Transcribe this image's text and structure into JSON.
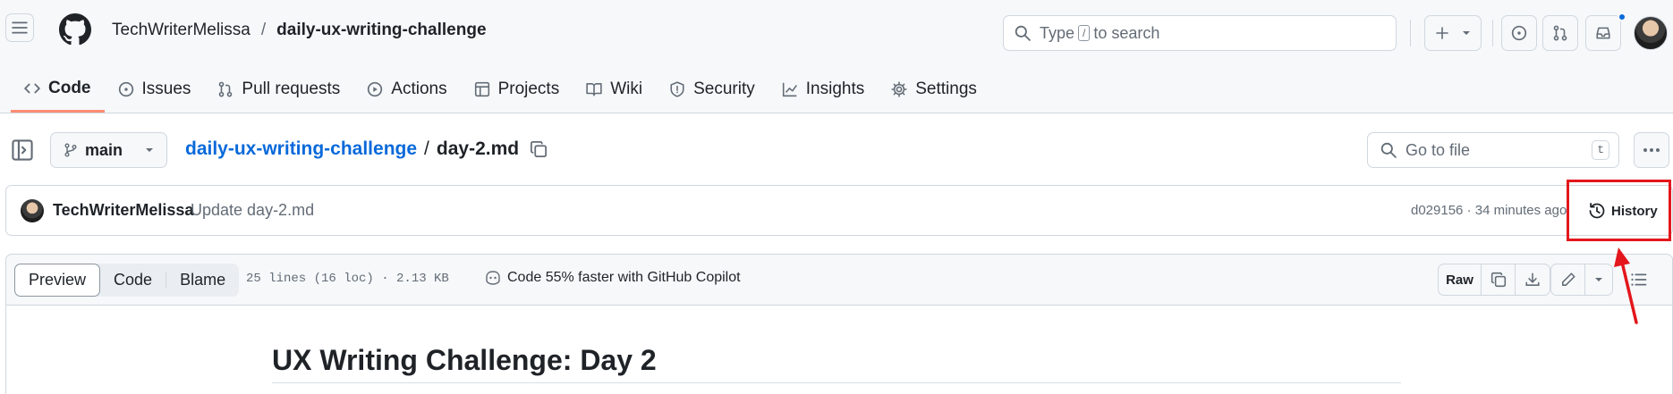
{
  "header": {
    "owner": "TechWriterMelissa",
    "separator": "/",
    "repo": "daily-ux-writing-challenge",
    "search": {
      "prefix": "Type",
      "key": "/",
      "suffix": "to search"
    }
  },
  "nav": {
    "tabs": [
      {
        "label": "Code",
        "icon": "code-icon",
        "active": true
      },
      {
        "label": "Issues",
        "icon": "issue-icon"
      },
      {
        "label": "Pull requests",
        "icon": "pull-request-icon"
      },
      {
        "label": "Actions",
        "icon": "play-icon"
      },
      {
        "label": "Projects",
        "icon": "table-icon"
      },
      {
        "label": "Wiki",
        "icon": "book-icon"
      },
      {
        "label": "Security",
        "icon": "shield-icon"
      },
      {
        "label": "Insights",
        "icon": "graph-icon"
      },
      {
        "label": "Settings",
        "icon": "gear-icon"
      }
    ]
  },
  "file_header": {
    "branch": "main",
    "repo_link": "daily-ux-writing-challenge",
    "slash": "/",
    "filename": "day-2.md",
    "goto_placeholder": "Go to file",
    "goto_key": "t"
  },
  "commit": {
    "author": "TechWriterMelissa",
    "message": "Update day-2.md",
    "meta": "d029156 · 34 minutes ago",
    "history_label": "History"
  },
  "viewer": {
    "modes": [
      "Preview",
      "Code",
      "Blame"
    ],
    "active_mode": "Preview",
    "file_info": "25 lines (16 loc) · 2.13 KB",
    "copilot_text": "Code 55% faster with GitHub Copilot",
    "raw_label": "Raw"
  },
  "content": {
    "title": "UX Writing Challenge: Day 2"
  },
  "annotation": {
    "highlight_color": "#e3171c"
  },
  "colors": {
    "accent": "#0969da",
    "tab_underline": "#fd8c73"
  }
}
